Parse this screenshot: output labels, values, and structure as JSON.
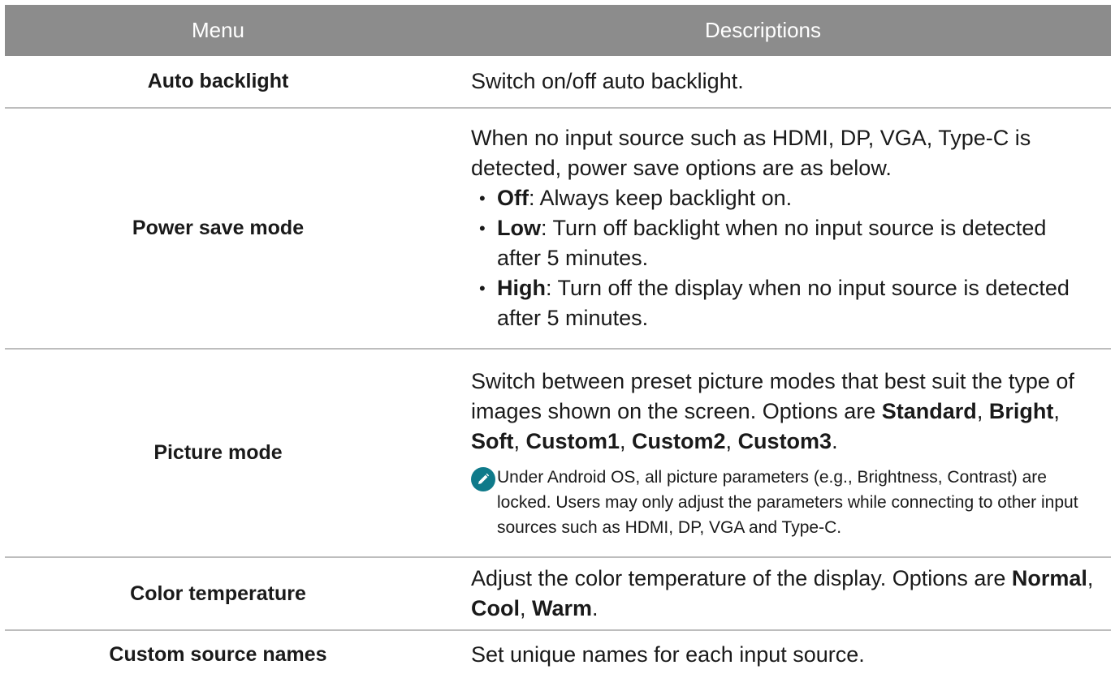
{
  "header": {
    "menu": "Menu",
    "descriptions": "Descriptions"
  },
  "rows": [
    {
      "menu": "Auto backlight",
      "desc": "Switch on/off auto backlight."
    },
    {
      "menu": "Power save mode",
      "desc": "When no input source such as HDMI, DP, VGA, Type-C is detected, power save options are as below.",
      "options": [
        {
          "name": "Off",
          "text": ": Always keep backlight on."
        },
        {
          "name": "Low",
          "text": ": Turn off backlight when no input source is detected after 5 minutes."
        },
        {
          "name": "High",
          "text": ": Turn off the display when no input source is detected after 5 minutes."
        }
      ]
    },
    {
      "menu": "Picture mode",
      "desc": "Switch between preset picture modes that best suit the type of images shown on the screen. Options are ",
      "options": [
        "Standard",
        "Bright",
        "Soft",
        "Custom1",
        "Custom2",
        "Custom3"
      ],
      "sep": ", ",
      "end": ".",
      "note": "Under Android OS, all picture parameters (e.g., Brightness, Contrast) are locked. Users may only adjust the parameters while connecting to other input sources such as HDMI, DP, VGA and Type-C.",
      "note_icon": "pencil-icon"
    },
    {
      "menu": "Color temperature",
      "desc": "Adjust the color temperature of the display. Options are ",
      "options": [
        "Normal",
        "Cool",
        "Warm"
      ],
      "sep": ", ",
      "end": "."
    },
    {
      "menu": "Custom source names",
      "desc": "Set unique names for each input source."
    }
  ],
  "colors": {
    "header_bg": "#8c8c8c",
    "note_icon": "#0f7a8a",
    "divider": "#bdbdbd"
  }
}
